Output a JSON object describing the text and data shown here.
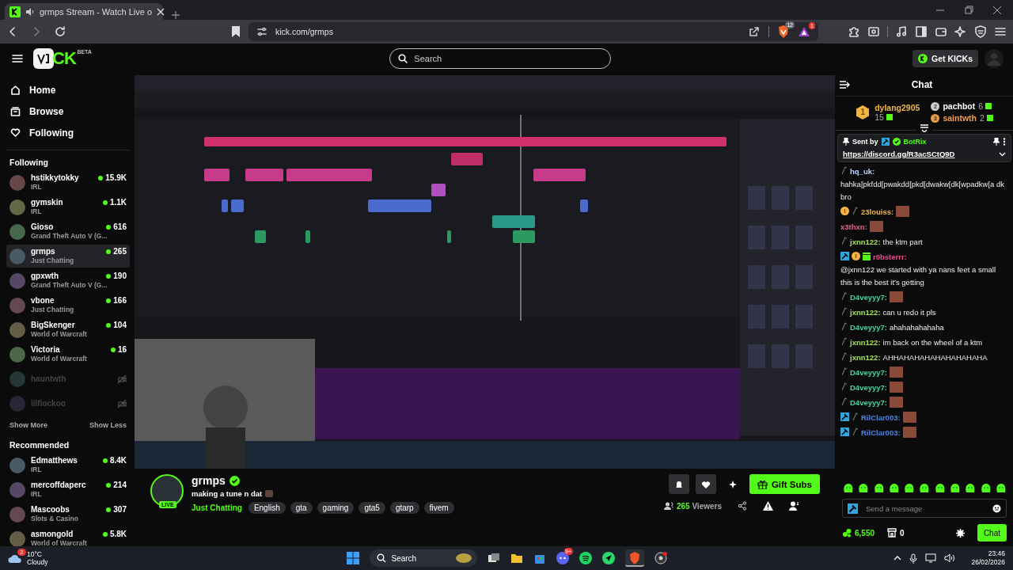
{
  "browser": {
    "tab_title": "grmps Stream - Watch Live o",
    "url": "kick.com/grmps",
    "shield_count": "12",
    "rewards_count": "1"
  },
  "header": {
    "logo": "CK",
    "logo_badge": "BETA",
    "search": {
      "placeholder": "Search"
    },
    "get_kicks": "Get KICKs"
  },
  "sidebar": {
    "nav": [
      {
        "label": "Home",
        "kind": "home"
      },
      {
        "label": "Browse",
        "kind": "browse"
      },
      {
        "label": "Following",
        "kind": "following"
      }
    ],
    "following_title": "Following",
    "following": [
      {
        "name": "hstikkytokky",
        "category": "IRL",
        "viewers": "15.9K",
        "live": true,
        "selected": false
      },
      {
        "name": "gymskin",
        "category": "IRL",
        "viewers": "1.1K",
        "live": true,
        "selected": false
      },
      {
        "name": "Gioso",
        "category": "Grand Theft Auto V (G...",
        "viewers": "616",
        "live": true,
        "selected": false
      },
      {
        "name": "grmps",
        "category": "Just Chatting",
        "viewers": "265",
        "live": true,
        "selected": true
      },
      {
        "name": "gpxwth",
        "category": "Grand Theft Auto V (G...",
        "viewers": "190",
        "live": true,
        "selected": false
      },
      {
        "name": "vbone",
        "category": "Just Chatting",
        "viewers": "166",
        "live": true,
        "selected": false
      },
      {
        "name": "BigSkenger",
        "category": "World of Warcraft",
        "viewers": "104",
        "live": true,
        "selected": false
      },
      {
        "name": "Victoria",
        "category": "World of Warcraft",
        "viewers": "16",
        "live": true,
        "selected": false
      },
      {
        "name": "hauntwth",
        "live": false,
        "selected": false
      },
      {
        "name": "lilflockoo",
        "live": false,
        "selected": false
      }
    ],
    "show_more": "Show More",
    "show_less": "Show Less",
    "recommended_title": "Recommended",
    "recommended": [
      {
        "name": "Edmatthews",
        "category": "IRL",
        "viewers": "8.4K",
        "live": true,
        "selected": false
      },
      {
        "name": "mercoffdaperc",
        "category": "IRL",
        "viewers": "214",
        "live": true,
        "selected": false
      },
      {
        "name": "Mascoobs",
        "category": "Slots & Casino",
        "viewers": "307",
        "live": true,
        "selected": false
      },
      {
        "name": "asmongold",
        "category": "World of Warcraft",
        "viewers": "5.8K",
        "live": true,
        "selected": false
      }
    ]
  },
  "stream": {
    "name": "grmps",
    "verified": true,
    "live_badge": "LIVE",
    "title": "making a tune n dat",
    "category": "Just Chatting",
    "tags": [
      "English",
      "gta",
      "gaming",
      "gta5",
      "gtarp",
      "fivem"
    ],
    "gift_button": "Gift Subs",
    "viewers": "265",
    "viewers_label": "Viewers"
  },
  "chat": {
    "title": "Chat",
    "leaderboard": [
      {
        "rank": "1",
        "name": "dylang2905",
        "count": "15",
        "color": "#f2b544"
      },
      {
        "rank": "2",
        "name": "pachbot",
        "count": "6",
        "color": "#ffffff"
      },
      {
        "rank": "3",
        "name": "saintwth",
        "count": "2",
        "color": "#f0a050"
      }
    ],
    "pinned": {
      "sent_by": "Sent by",
      "author": "BotRix",
      "link": "https://discord.gg/R3acSCtQ9D"
    },
    "messages": [
      {
        "badges": [
          {
            "kind": "sub"
          }
        ],
        "user": "hq_uk:",
        "color": "#b8d4ff",
        "text": "hahka[pkfdd[pwakdd[pkd[dwakw[dk[wpadkw[a dk bro",
        "emote": false
      },
      {
        "badges": [
          {
            "kind": "rank"
          },
          {
            "kind": "sub"
          }
        ],
        "user": "23louiss:",
        "color": "#f2b544",
        "emote": true
      },
      {
        "user": "x3thxn:",
        "color": "#e8609a",
        "emote": true
      },
      {
        "badges": [
          {
            "kind": "sub"
          }
        ],
        "user": "jxnn122:",
        "color": "#a4e05a",
        "text": "the ktm part",
        "emote": false
      },
      {
        "badges": [
          {
            "kind": "mod"
          },
          {
            "kind": "rank"
          },
          {
            "kind": "gift"
          }
        ],
        "user": "r0bsterrr:",
        "color": "#e8508c",
        "text": "@jxnn122 we started with ya nans feet a small this is the best it's getting",
        "emote": false
      },
      {
        "badges": [
          {
            "kind": "sub"
          }
        ],
        "user": "D4veyyy7:",
        "color": "#3ed6a0",
        "emote": true
      },
      {
        "badges": [
          {
            "kind": "sub"
          }
        ],
        "user": "jxnn122:",
        "color": "#a4e05a",
        "text": "can u redo it pls",
        "emote": false
      },
      {
        "badges": [
          {
            "kind": "sub"
          }
        ],
        "user": "D4veyyy7:",
        "color": "#3ed6a0",
        "text": "ahahahahahaha",
        "emote": false
      },
      {
        "badges": [
          {
            "kind": "sub"
          }
        ],
        "user": "jxnn122:",
        "color": "#a4e05a",
        "text": "im back on the wheel of a ktm",
        "emote": false
      },
      {
        "badges": [
          {
            "kind": "sub"
          }
        ],
        "user": "jxnn122:",
        "color": "#a4e05a",
        "text": "AHHAHAHAHAHAHAHAHAHA",
        "emote": false
      },
      {
        "badges": [
          {
            "kind": "sub"
          }
        ],
        "user": "D4veyyy7:",
        "color": "#3ed6a0",
        "emote": true
      },
      {
        "badges": [
          {
            "kind": "sub"
          }
        ],
        "user": "D4veyyy7:",
        "color": "#3ed6a0",
        "emote": true
      },
      {
        "badges": [
          {
            "kind": "sub"
          }
        ],
        "user": "D4veyyy7:",
        "color": "#3ed6a0",
        "emote": true
      },
      {
        "badges": [
          {
            "kind": "mod"
          },
          {
            "kind": "sub"
          }
        ],
        "user": "RilClar003:",
        "color": "#4a86e8",
        "emote": true
      },
      {
        "badges": [
          {
            "kind": "mod"
          },
          {
            "kind": "sub"
          }
        ],
        "user": "RilClar003:",
        "color": "#4a86e8",
        "emote": true
      }
    ],
    "input": {
      "placeholder": "Send a message"
    },
    "points": "6,550",
    "store_count": "0",
    "send_button": "Chat"
  },
  "taskbar": {
    "weather_badge": "2",
    "temperature": "10°C",
    "condition": "Cloudy",
    "search": "Search",
    "discord_badge": "9+",
    "time": "23:46",
    "date": "26/02/2026"
  }
}
